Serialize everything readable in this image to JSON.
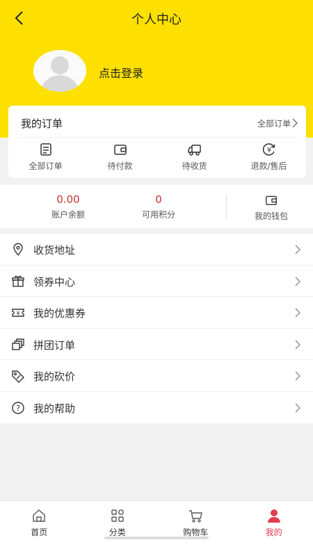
{
  "header": {
    "title": "个人中心"
  },
  "profile": {
    "login_label": "点击登录"
  },
  "orders": {
    "title": "我的订单",
    "all_link": "全部订单",
    "items": [
      {
        "label": "全部订单",
        "icon": "order-list-icon"
      },
      {
        "label": "待付款",
        "icon": "wallet-icon"
      },
      {
        "label": "待收货",
        "icon": "truck-icon"
      },
      {
        "label": "退款/售后",
        "icon": "refund-icon"
      }
    ]
  },
  "account": {
    "balance_value": "0.00",
    "balance_label": "账户余额",
    "points_value": "0",
    "points_label": "可用积分",
    "wallet_label": "我的钱包"
  },
  "menu": [
    {
      "label": "收货地址",
      "icon": "location-icon"
    },
    {
      "label": "领券中心",
      "icon": "gift-icon"
    },
    {
      "label": "我的优惠券",
      "icon": "coupon-icon"
    },
    {
      "label": "拼团订单",
      "icon": "group-order-icon"
    },
    {
      "label": "我的砍价",
      "icon": "price-tag-icon"
    },
    {
      "label": "我的帮助",
      "icon": "help-icon"
    }
  ],
  "tabbar": [
    {
      "label": "首页",
      "icon": "home-icon"
    },
    {
      "label": "分类",
      "icon": "category-icon"
    },
    {
      "label": "购物车",
      "icon": "cart-icon"
    },
    {
      "label": "我的",
      "icon": "user-icon",
      "active": true
    }
  ],
  "colors": {
    "header_bg": "#fde000",
    "accent_red": "#c9322e",
    "active_tab": "#e23b52"
  }
}
